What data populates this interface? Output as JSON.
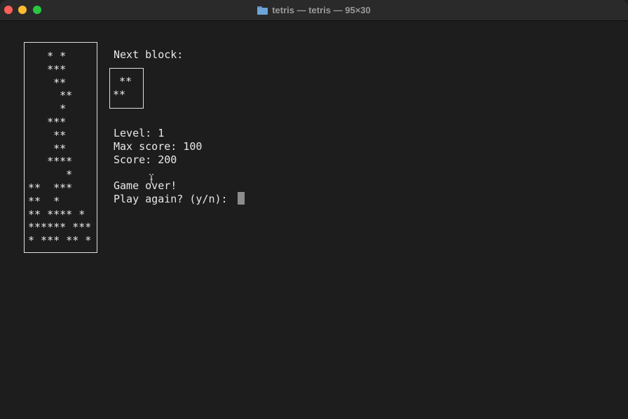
{
  "window": {
    "title": "tetris — tetris — 95×30"
  },
  "board": {
    "rows": [
      "   * *",
      "   ***",
      "    **",
      "     **",
      "     *",
      "   ***",
      "    **",
      "    **",
      "   ****",
      "      *",
      "**  ***",
      "**  *",
      "** **** *",
      "****** ***",
      "* *** ** *"
    ]
  },
  "next_block": {
    "label": "Next block:",
    "rows": [
      " **",
      "**"
    ]
  },
  "stats": {
    "level": "Level: 1",
    "max_score": "Max score: 100",
    "score": "Score: 200"
  },
  "game_over": {
    "message": "Game over!",
    "prompt": "Play again? (y/n): "
  },
  "colors": {
    "background": "#1d1d1d",
    "text": "#e8e8e8",
    "close": "#ff5f57",
    "minimize": "#febc2e",
    "maximize": "#28c840"
  }
}
